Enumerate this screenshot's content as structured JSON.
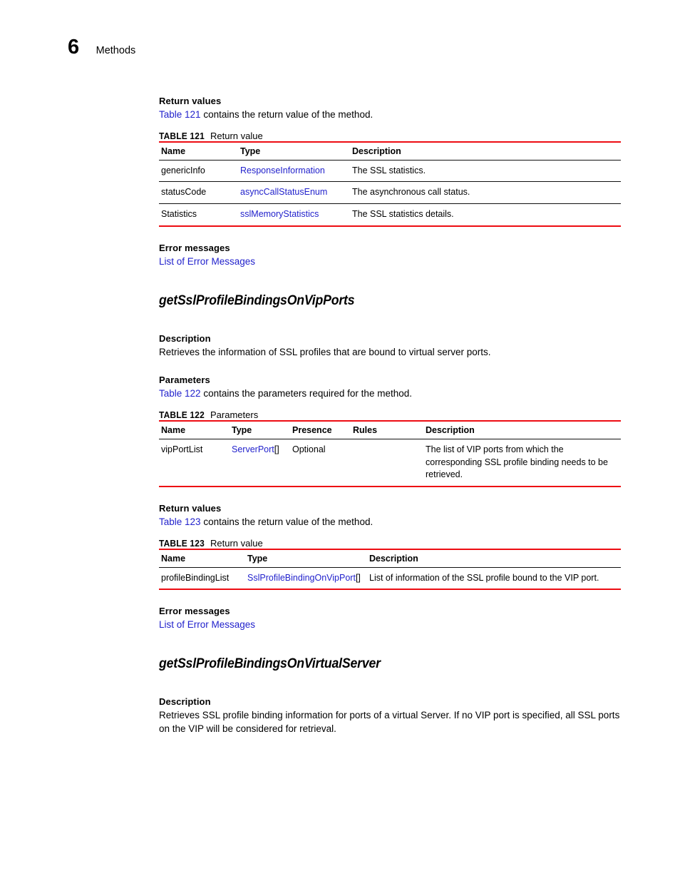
{
  "header": {
    "chapter_number": "6",
    "chapter_title": "Methods"
  },
  "colors": {
    "link_blue": "#2222cc",
    "rule_red": "#ed0c12",
    "rule_dark": "#111111",
    "text": "#000000"
  },
  "sections": {
    "return_values_1": {
      "label": "Return values",
      "xref": "Table 121",
      "sentence": " contains the return value of the method."
    },
    "error_messages_1": {
      "label": "Error messages",
      "link": "List of Error Messages"
    },
    "method_1": {
      "heading": "getSslProfileBindingsOnVipPorts",
      "description_label": "Description",
      "description_text": "Retrieves the information of SSL profiles that are bound to virtual server ports.",
      "parameters_label": "Parameters",
      "parameters_xref": "Table 122",
      "parameters_sentence": " contains the parameters required for the method."
    },
    "return_values_2": {
      "label": "Return values",
      "xref": "Table 123",
      "sentence": " contains the return value of the method."
    },
    "error_messages_2": {
      "label": "Error messages",
      "link": "List of Error Messages"
    },
    "method_2": {
      "heading": "getSslProfileBindingsOnVirtualServer",
      "description_label": "Description",
      "description_text": "Retrieves SSL profile binding information for ports of a virtual Server. If no VIP port is specified, all SSL ports on the VIP will be considered for retrieval."
    }
  },
  "tables": {
    "table121": {
      "number": "TABLE 121",
      "caption": "Return value",
      "columns": [
        "Name",
        "Type",
        "Description"
      ],
      "rows": [
        {
          "name": "genericInfo",
          "type": "ResponseInformation",
          "type_suffix": "",
          "description": "The SSL statistics."
        },
        {
          "name": "statusCode",
          "type": "asyncCallStatusEnum",
          "type_suffix": "",
          "description": "The asynchronous call status."
        },
        {
          "name": "Statistics",
          "type": "sslMemoryStatistics",
          "type_suffix": "",
          "description": "The SSL statistics details."
        }
      ]
    },
    "table122": {
      "number": "TABLE 122",
      "caption": "Parameters",
      "columns": [
        "Name",
        "Type",
        "Presence",
        "Rules",
        "Description"
      ],
      "rows": [
        {
          "name": "vipPortList",
          "type": "ServerPort",
          "type_suffix": "[]",
          "presence": "Optional",
          "rules": "",
          "description": "The list of VIP ports from which the corresponding SSL profile binding needs to be retrieved."
        }
      ]
    },
    "table123": {
      "number": "TABLE 123",
      "caption": "Return value",
      "columns": [
        "Name",
        "Type",
        "Description"
      ],
      "rows": [
        {
          "name": "profileBindingList",
          "type": "SslProfileBindingOnVipPort",
          "type_suffix": "[]",
          "description": "List of information of the SSL profile bound to the VIP port."
        }
      ]
    }
  }
}
